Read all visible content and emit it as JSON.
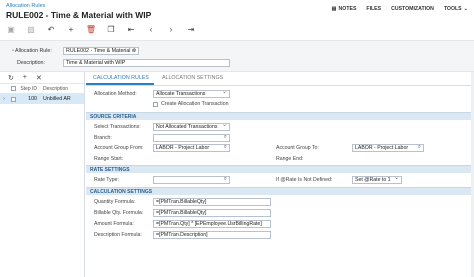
{
  "header": {
    "breadcrumb": "Allocation Rules",
    "title": "RULE002 - Time & Material with WIP",
    "menu": [
      "NOTES",
      "FILES",
      "CUSTOMIZATION",
      "TOOLS"
    ]
  },
  "toolbar": {
    "icons": [
      "save-icon",
      "save-close-icon",
      "undo-icon",
      "add-icon",
      "delete-icon",
      "copy-icon",
      "first-icon",
      "prev-icon",
      "next-icon",
      "last-icon"
    ]
  },
  "form": {
    "allocation_rule_label": "Allocation Rule:",
    "allocation_rule_value": "RULE002 - Time & Material w",
    "description_label": "Description:",
    "description_value": "Time & Material with WIP"
  },
  "steps": {
    "columns": [
      "Step ID",
      "Description"
    ],
    "rows": [
      {
        "step_id": "100",
        "description": "Unbilled AR"
      }
    ]
  },
  "tabs": [
    "CALCULATION RULES",
    "ALLOCATION SETTINGS"
  ],
  "rules": {
    "allocation_method_label": "Allocation Method:",
    "allocation_method_value": "Allocate Transactions",
    "create_allocation_label": "Create Allocation Transaction",
    "source_criteria": "SOURCE CRITERIA",
    "select_transactions_label": "Select Transactions:",
    "select_transactions_value": "Not Allocated Transactions",
    "branch_label": "Branch:",
    "branch_value": "",
    "account_group_from_label": "Account Group From:",
    "account_group_from_value": "LABOR - Project Labor",
    "account_group_to_label": "Account Group To:",
    "account_group_to_value": "LABOR - Project Labor",
    "range_start_label": "Range Start:",
    "range_end_label": "Range End:",
    "rate_settings": "RATE SETTINGS",
    "rate_type_label": "Rate Type:",
    "rate_type_value": "",
    "if_rate_label": "If @Rate Is Not Defined:",
    "if_rate_value": "Set @Rate to 1",
    "calculation_settings": "CALCULATION SETTINGS",
    "quantity_formula_label": "Quantity Formula:",
    "quantity_formula_value": "=[PMTran.BillableQty]",
    "billable_qty_formula_label": "Billable Qty. Formula:",
    "billable_qty_formula_value": "=[PMTran.BillableQty]",
    "amount_formula_label": "Amount Formula:",
    "amount_formula_value": "=[PMTran.Qty] * [EPEmployee.UsrBillingRate]",
    "description_formula_label": "Description Formula:",
    "description_formula_value": "=[PMTran.Description]"
  }
}
